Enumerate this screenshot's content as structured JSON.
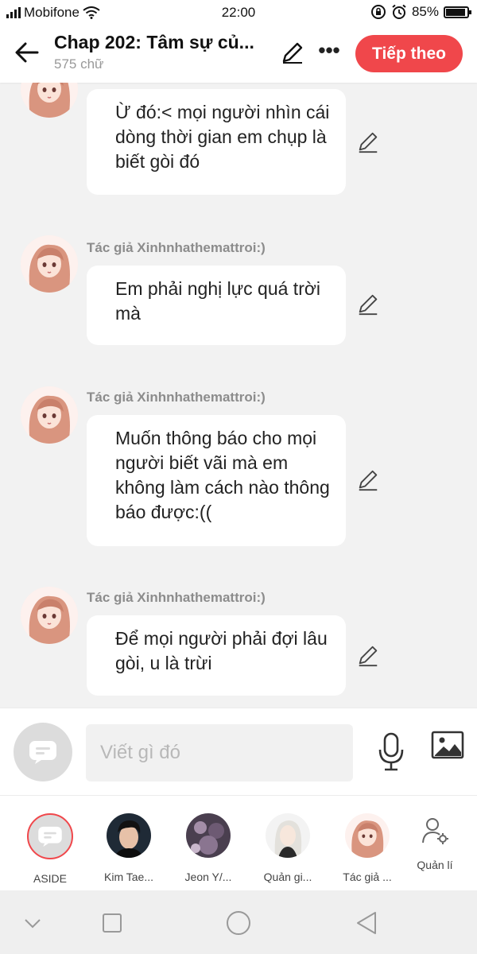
{
  "status_bar": {
    "carrier": "Mobifone",
    "time": "22:00",
    "battery": "85%",
    "battery_level": 0.85
  },
  "header": {
    "title": "Chap 202: Tâm sự củ...",
    "word_count": "575 chữ",
    "next_label": "Tiếp theo"
  },
  "messages": [
    {
      "author": "",
      "text": "Ừ đó:< mọi người nhìn cái dòng thời gian em chụp là biết gòi đó"
    },
    {
      "author": "Tác giả Xinhnhathemattroi:)",
      "text": "Em phải nghị lực quá trời mà"
    },
    {
      "author": "Tác giả Xinhnhathemattroi:)",
      "text": "Muốn thông báo cho mọi người biết vãi mà em không làm cách nào thông báo được:(("
    },
    {
      "author": "Tác giả Xinhnhathemattroi:)",
      "text": "Để mọi người phải đợi lâu gòi, u là trừi"
    }
  ],
  "composer": {
    "placeholder": "Viết gì đó"
  },
  "characters": [
    {
      "name": "ASIDE"
    },
    {
      "name": "Kim Tae..."
    },
    {
      "name": "Jeon Y/..."
    },
    {
      "name": "Quản gi..."
    },
    {
      "name": "Tác giả ..."
    },
    {
      "name": "Quản lí"
    }
  ],
  "colors": {
    "accent": "#f0474b",
    "background": "#f2f2f2",
    "bubble": "#ffffff",
    "author_text": "#8c8c8c"
  },
  "icons": [
    "back-arrow-icon",
    "pencil-icon",
    "more-icon",
    "aside-icon",
    "mic-icon",
    "image-icon",
    "manage-user-icon",
    "nav-down-icon",
    "nav-recent-icon",
    "nav-home-icon",
    "nav-back-icon"
  ]
}
